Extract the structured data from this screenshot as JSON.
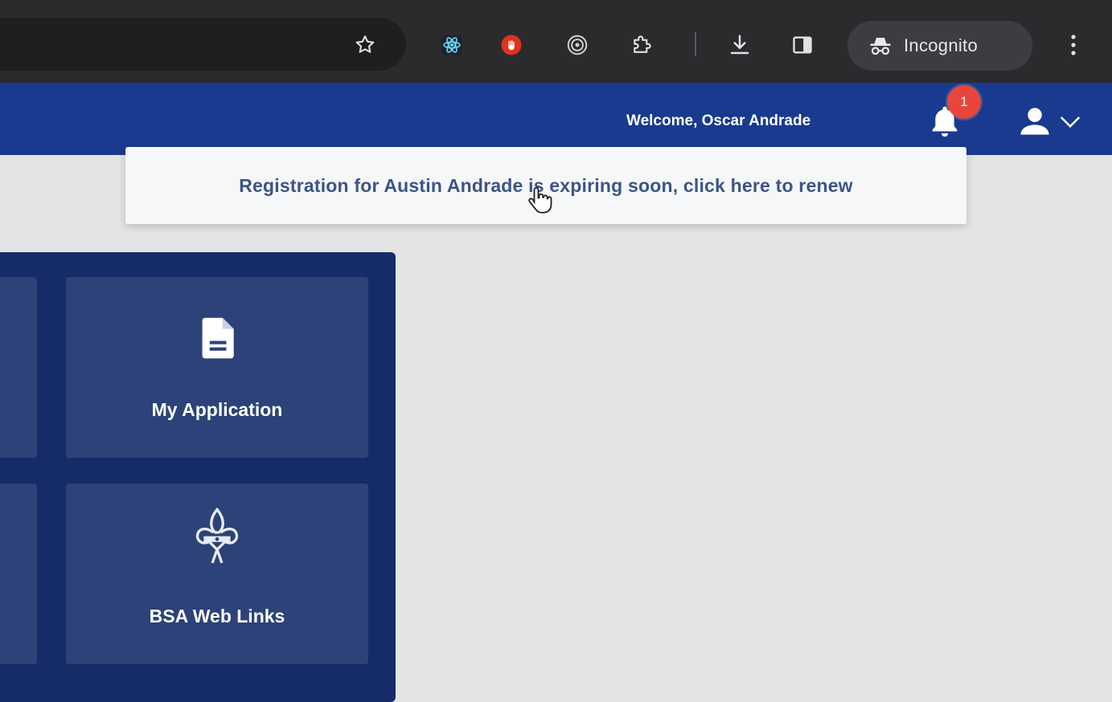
{
  "browser": {
    "incognito_label": "Incognito",
    "icons": {
      "bookmark": "star-icon",
      "extensions": [
        "react-devtools-icon",
        "stop-extension-icon",
        "target-extension-icon",
        "puzzle-icon"
      ],
      "download": "download-icon",
      "side_panel": "side-panel-icon",
      "incognito": "incognito-icon",
      "menu": "kebab-menu-icon"
    }
  },
  "header": {
    "welcome_text": "Welcome, Oscar Andrade",
    "notification_count": "1",
    "background_color": "#1a3a8f",
    "badge_color": "#e8453c"
  },
  "notification": {
    "message": "Registration for Austin Andrade is expiring soon, click here to renew",
    "text_color": "#3d5487"
  },
  "dashboard": {
    "tiles": [
      {
        "label": "My Application",
        "icon": "document-icon"
      },
      {
        "label": "BSA Web Links",
        "icon": "fleur-de-lis-icon"
      }
    ],
    "panel_color": "#152c69",
    "tile_color": "#2c4278"
  }
}
